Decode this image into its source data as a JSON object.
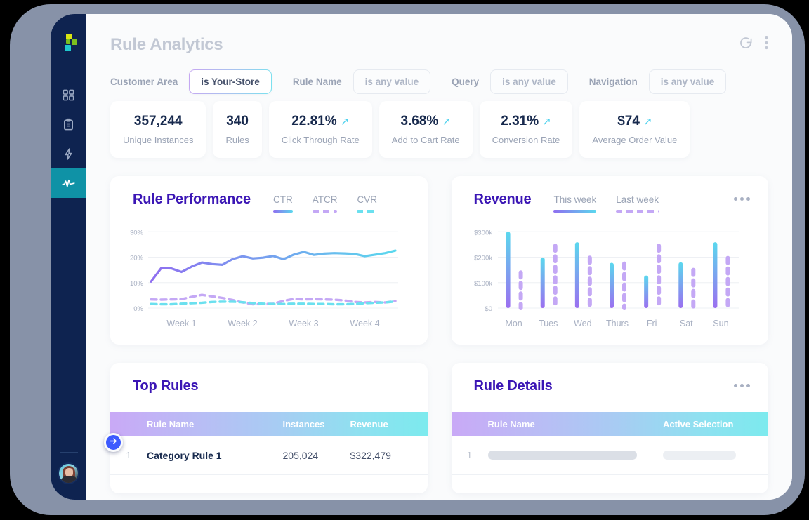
{
  "app": {
    "page_title": "Rule Analytics",
    "header_icons": [
      "refresh-icon",
      "more-vertical-icon"
    ]
  },
  "sidebar": {
    "logo": {
      "name": "brand-logo",
      "colors": [
        "#d8e413",
        "#7cbf1e",
        "#1fc8cd"
      ]
    },
    "items": [
      {
        "id": "dashboard",
        "icon": "grid-icon",
        "active": false
      },
      {
        "id": "catalog",
        "icon": "clipboard-icon",
        "active": false
      },
      {
        "id": "automation",
        "icon": "bolt-icon",
        "active": false
      },
      {
        "id": "analytics",
        "icon": "pulse-icon",
        "active": true
      }
    ],
    "active_color": "#0f92a6",
    "background": "#0e2350",
    "expand_button": {
      "icon": "arrow-right-icon",
      "color": "#3d5afe"
    },
    "avatar": {
      "name": "user-avatar"
    }
  },
  "filters": [
    {
      "label": "Customer Area",
      "value": "is Your-Store",
      "active": true
    },
    {
      "label": "Rule Name",
      "value": "is any value",
      "active": false
    },
    {
      "label": "Query",
      "value": "is any value",
      "active": false
    },
    {
      "label": "Navigation",
      "value": "is any value",
      "active": false
    }
  ],
  "kpis": [
    {
      "value": "357,244",
      "label": "Unique Instances",
      "trend": false
    },
    {
      "value": "340",
      "label": "Rules",
      "trend": false
    },
    {
      "value": "22.81%",
      "label": "Click Through Rate",
      "trend": true
    },
    {
      "value": "3.68%",
      "label": "Add to Cart Rate",
      "trend": true
    },
    {
      "value": "2.31%",
      "label": "Conversion Rate",
      "trend": true
    },
    {
      "value": "$74",
      "label": "Average Order Value",
      "trend": true
    }
  ],
  "cards": {
    "rule_performance": {
      "title": "Rule Performance",
      "legend": [
        {
          "label": "CTR",
          "style": "solid-grad"
        },
        {
          "label": "ATCR",
          "style": "dash-purple"
        },
        {
          "label": "CVR",
          "style": "dash-cyan"
        }
      ]
    },
    "revenue": {
      "title": "Revenue",
      "legend": [
        {
          "label": "This week",
          "style": "solid-grad"
        },
        {
          "label": "Last week",
          "style": "dash-purple"
        }
      ],
      "menu_icon": "more-horizontal-icon"
    },
    "top_rules": {
      "title": "Top Rules",
      "columns": [
        "",
        "Rule Name",
        "Instances",
        "Revenue"
      ],
      "rows": [
        {
          "index": "1",
          "name": "Category Rule 1",
          "instances": "205,024",
          "revenue": "$322,479"
        }
      ]
    },
    "rule_details": {
      "title": "Rule Details",
      "menu_icon": "more-horizontal-icon",
      "columns": [
        "",
        "Rule Name",
        "Active Selection"
      ],
      "rows": [
        {
          "index": "1",
          "name": "",
          "selection": ""
        }
      ]
    }
  },
  "chart_data": [
    {
      "type": "line",
      "title": "Rule Performance",
      "xlabel": "",
      "ylabel": "",
      "ylim": [
        0,
        32
      ],
      "ytick_labels": [
        "0%",
        "10%",
        "20%",
        "30%"
      ],
      "yticks": [
        0,
        10,
        20,
        30
      ],
      "tick_labels": [
        "Week 1",
        "Week 2",
        "Week 3",
        "Week 4"
      ],
      "grid": true,
      "legend_position": "top-right",
      "series": [
        {
          "name": "CTR",
          "style": "solid",
          "color_start": "#8f6ef0",
          "color_end": "#5ad8ee",
          "values": [
            10.4,
            15.7,
            15.6,
            14.2,
            16.3,
            17.9,
            17.3,
            17.0,
            19.2,
            20.4,
            19.5,
            19.8,
            20.5,
            19.2,
            21.0,
            22.1,
            20.9,
            21.4,
            21.6,
            21.5,
            21.3,
            20.4,
            21.0,
            21.6,
            22.6
          ]
        },
        {
          "name": "ATCR",
          "style": "dashed",
          "color": "#c4a8f5",
          "values": [
            3.4,
            3.3,
            3.4,
            3.5,
            4.4,
            5.2,
            4.6,
            4.0,
            3.2,
            2.2,
            1.5,
            1.6,
            1.7,
            2.8,
            3.6,
            3.4,
            3.5,
            3.4,
            3.3,
            3.0,
            2.4,
            2.2,
            2.4,
            2.2,
            2.8
          ]
        },
        {
          "name": "CVR",
          "style": "dashed",
          "color": "#6be0ef",
          "values": [
            1.6,
            1.5,
            1.5,
            1.7,
            1.9,
            2.1,
            2.4,
            2.5,
            2.5,
            2.3,
            2.0,
            1.7,
            1.6,
            1.6,
            1.7,
            1.7,
            1.6,
            1.6,
            1.5,
            1.5,
            1.6,
            1.9,
            2.1,
            2.2,
            2.6
          ]
        }
      ]
    },
    {
      "type": "bar",
      "title": "Revenue",
      "xlabel": "",
      "ylabel": "",
      "ylim": [
        0,
        320
      ],
      "yticks": [
        0,
        100,
        200,
        300
      ],
      "ytick_labels": [
        "$0",
        "$100k",
        "$200k",
        "$300k"
      ],
      "categories": [
        "Mon",
        "Tues",
        "Wed",
        "Thurs",
        "Fri",
        "Sat",
        "Sun"
      ],
      "grid": true,
      "legend_position": "top-center",
      "series": [
        {
          "name": "This week",
          "style": "solid",
          "color_start": "#9b6ff0",
          "color_end": "#5ad8ee",
          "values": [
            300,
            199,
            259,
            178,
            128,
            180,
            259
          ]
        },
        {
          "name": "Last week",
          "style": "dashed",
          "color": "#c4a8f5",
          "values": [
            140,
            245,
            198,
            175,
            245,
            150,
            197
          ]
        }
      ]
    }
  ]
}
